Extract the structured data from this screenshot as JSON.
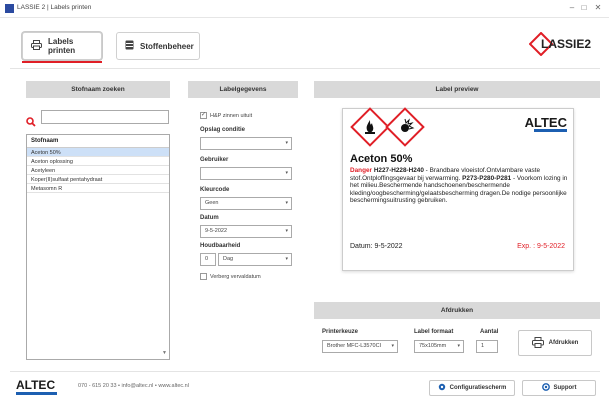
{
  "window": {
    "title": "LASSIE 2 | Labels printen",
    "minimize": "–",
    "maximize": "□",
    "close": "✕"
  },
  "tabs": [
    {
      "label": "Labels printen",
      "icon": "printer-icon",
      "active": true
    },
    {
      "label": "Stoffenbeheer",
      "icon": "database-icon",
      "active": false
    }
  ],
  "brand": {
    "logo_text": "LASSIE2",
    "accent": "#e01e26",
    "blue": "#1c5fb1"
  },
  "search_panel": {
    "header": "Stofnaam zoeken",
    "search_value": "",
    "list_header": "Stofnaam",
    "items": [
      "Aceton 50%",
      "Aceton oplossing",
      "Acetyleen",
      "Koper(II)sulfaat pentahydraat",
      "Metasomn R"
    ],
    "selected_index": 0
  },
  "label_panel": {
    "header": "Labelgegevens",
    "hp_checkbox": "H&P zinnen uituit",
    "hp_checked": true,
    "opslag_label": "Opslag conditie",
    "opslag_value": "",
    "gebruiker_label": "Gebruiker",
    "gebruiker_value": "",
    "kleurcode_label": "Kleurcode",
    "kleurcode_value": "Geen",
    "datum_label": "Datum",
    "datum_value": "9-5-2022",
    "houdbaarheid_label": "Houdbaarheid",
    "houdbaarheid_num": "0",
    "houdbaarheid_unit": "Dag",
    "verberg_checkbox": "Verberg vervaldatum",
    "verberg_checked": false
  },
  "preview": {
    "header": "Label preview",
    "brand": "ALTEC",
    "substance": "Aceton 50%",
    "danger_word": "Danger",
    "hcodes": "H227-H228-H240",
    "text_part1": " - Brandbare vloeistof.Ontvlambare vaste stof.Ontploffingsgevaar bij verwarming. ",
    "pcodes": "P273-P280-P281",
    "text_part2": " - Voorkom lozing in het milieu.Beschermende handschoenen/beschermende kleding/oogbescherming/gelaatsbescherming dragen.De nodige persoonlijke beschermingsuitrusting gebruiken.",
    "date_text": "Datum: 9-5-2022",
    "exp_text": "Exp. :  9-5-2022"
  },
  "print_panel": {
    "header": "Afdrukken",
    "printer_label": "Printerkeuze",
    "printer_value": "Brother MFC-L3570CI",
    "format_label": "Label formaat",
    "format_value": "75x105mm",
    "aantal_label": "Aantal",
    "aantal_value": "1",
    "print_button": "Afdrukken"
  },
  "footer": {
    "logo": "ALTEC",
    "contact": "070 - 615 20 33   •   info@altec.nl   •   www.altec.nl",
    "config_button": "Configuratiescherm",
    "support_button": "Support"
  }
}
